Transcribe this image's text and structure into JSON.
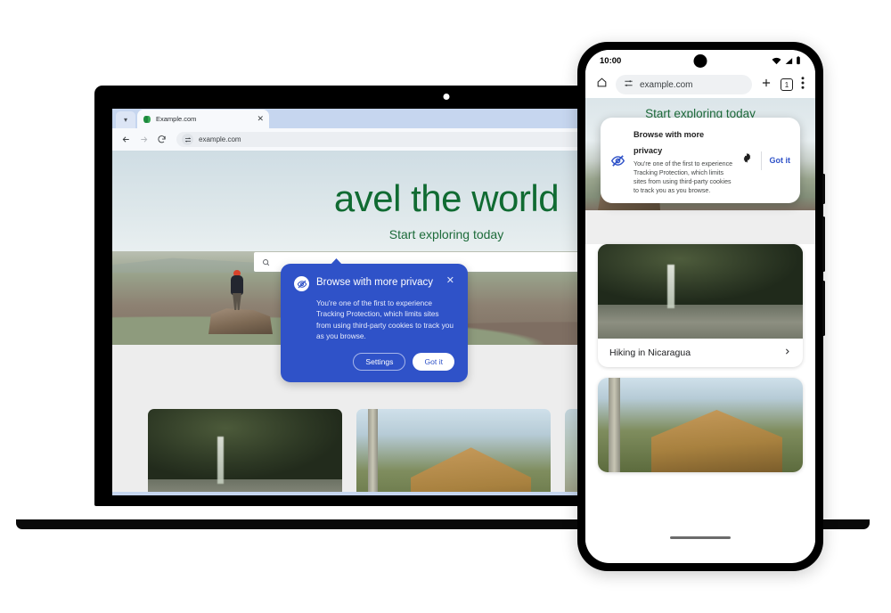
{
  "colors": {
    "dialog_blue": "#2f52c8",
    "brand_green": "#106b32",
    "carousel_next": "#146c2e",
    "carousel_prev": "#b4b7b6",
    "link_blue": "#2f52c8"
  },
  "laptop": {
    "tab": {
      "title": "Example.com",
      "favicon_icon": "example-favicon-icon",
      "close_icon": "close-icon",
      "chevron_icon": "chevron-down-icon"
    },
    "toolbar": {
      "back_icon": "back-arrow-icon",
      "forward_icon": "forward-arrow-icon",
      "reload_icon": "reload-icon",
      "site_settings_icon": "tune-sliders-icon",
      "url": "example.com"
    },
    "page": {
      "hero_title": "avel the world",
      "hero_subtitle": "Start exploring today",
      "search_icon": "search-icon",
      "search_placeholder": "",
      "carousel_prev_icon": "chevron-left-icon",
      "carousel_next_icon": "chevron-right-icon",
      "cards": [
        {
          "name": "waterfall-hiker-card"
        },
        {
          "name": "log-cabin-card"
        },
        {
          "name": "third-card"
        }
      ]
    },
    "dialog": {
      "icon": "eye-slash-icon",
      "title": "Browse with more privacy",
      "close_icon": "close-icon",
      "body": "You're one of the first to experience Tracking Protection, which limits sites from using third-party cookies to track you as you browse.",
      "secondary_button": "Settings",
      "primary_button": "Got it"
    },
    "webcam_icon": "webcam-dot-icon"
  },
  "phone": {
    "status": {
      "time": "10:00",
      "wifi_icon": "wifi-icon",
      "signal_icon": "cellular-signal-icon",
      "battery_icon": "battery-icon",
      "camera_icon": "front-camera-icon"
    },
    "toolbar": {
      "home_icon": "home-icon",
      "site_settings_icon": "tune-sliders-icon",
      "url": "example.com",
      "new_tab_icon": "plus-icon",
      "tab_count": "1",
      "menu_icon": "more-vert-icon"
    },
    "dialog": {
      "icon": "eye-slash-icon",
      "title": "Browse with more privacy",
      "body": "You're one of the first to experience Tracking Protection, which limits sites from using third-party cookies to track you as you browse.",
      "settings_icon": "gear-icon",
      "primary_button": "Got it"
    },
    "page": {
      "hero_subtitle": "Start exploring today",
      "search_icon": "search-icon",
      "search_placeholder": "",
      "cards": [
        {
          "label": "Hiking in Nicaragua",
          "chevron_icon": "chevron-right-icon",
          "image": "waterfall-hiker-image"
        },
        {
          "label": "",
          "chevron_icon": "chevron-right-icon",
          "image": "log-cabin-image"
        }
      ]
    },
    "home_indicator_icon": "home-indicator-icon"
  }
}
